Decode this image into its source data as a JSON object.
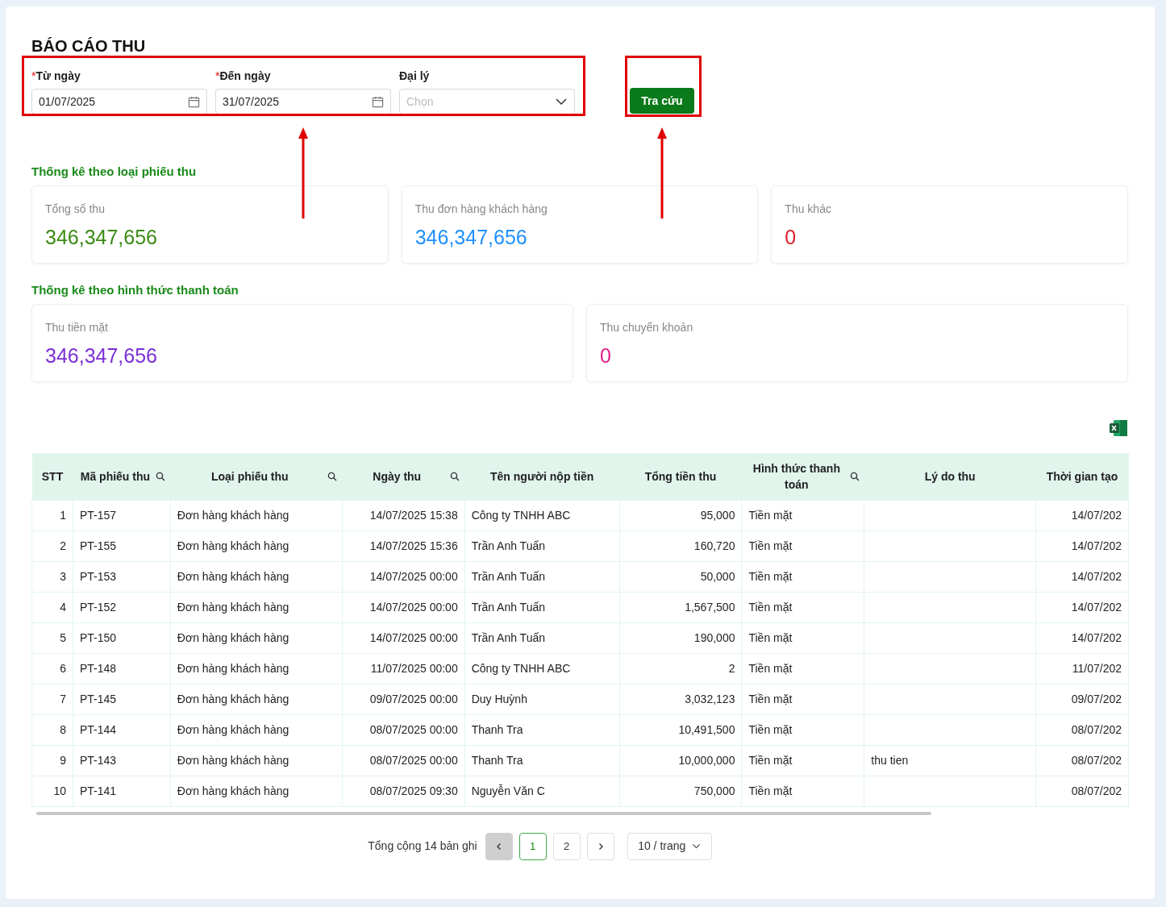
{
  "title": "BÁO CÁO THU",
  "filters": [
    {
      "kind": "date",
      "required_mark": "*",
      "label": "Từ ngày",
      "value": "01/07/2025"
    },
    {
      "kind": "date",
      "required_mark": "*",
      "label": "Đến ngày",
      "value": "31/07/2025"
    },
    {
      "kind": "select",
      "label": "Đại lý",
      "placeholder": "Chọn"
    }
  ],
  "search_button": "Tra cứu",
  "sections": [
    {
      "title": "Thống kê theo loại phiếu thu",
      "cards": [
        {
          "label": "Tổng số thu",
          "value": "346,347,656",
          "color": "#3a8a14"
        },
        {
          "label": "Thu đơn hàng khách hàng",
          "value": "346,347,656",
          "color": "#1e90ff"
        },
        {
          "label": "Thu khác",
          "value": "0",
          "color": "#e0202a"
        }
      ]
    },
    {
      "title": "Thống kê theo hình thức thanh toán",
      "cards": [
        {
          "label": "Thu tiền mặt",
          "value": "346,347,656",
          "color": "#7b2fd6"
        },
        {
          "label": "Thu chuyển khoản",
          "value": "0",
          "color": "#e0208a"
        }
      ]
    }
  ],
  "table": {
    "columns": [
      {
        "label": "STT",
        "searchable": false
      },
      {
        "label": "Mã phiếu thu",
        "searchable": true
      },
      {
        "label": "Loại phiếu thu",
        "searchable": true
      },
      {
        "label": "Ngày thu",
        "searchable": true
      },
      {
        "label": "Tên người nộp tiền",
        "searchable": false
      },
      {
        "label": "Tổng tiền thu",
        "searchable": false
      },
      {
        "label": "Hình thức thanh toán",
        "searchable": true
      },
      {
        "label": "Lý do thu",
        "searchable": false
      },
      {
        "label": "Thời gian tạo",
        "searchable": false
      }
    ],
    "rows": [
      [
        "1",
        "PT-157",
        "Đơn hàng khách hàng",
        "14/07/2025 15:38",
        "Công ty TNHH ABC",
        "95,000",
        "Tiền mặt",
        "",
        "14/07/202"
      ],
      [
        "2",
        "PT-155",
        "Đơn hàng khách hàng",
        "14/07/2025 15:36",
        "Trần Anh Tuấn",
        "160,720",
        "Tiền mặt",
        "",
        "14/07/202"
      ],
      [
        "3",
        "PT-153",
        "Đơn hàng khách hàng",
        "14/07/2025 00:00",
        "Trần Anh Tuấn",
        "50,000",
        "Tiền mặt",
        "",
        "14/07/202"
      ],
      [
        "4",
        "PT-152",
        "Đơn hàng khách hàng",
        "14/07/2025 00:00",
        "Trần Anh Tuấn",
        "1,567,500",
        "Tiền mặt",
        "",
        "14/07/202"
      ],
      [
        "5",
        "PT-150",
        "Đơn hàng khách hàng",
        "14/07/2025 00:00",
        "Trần Anh Tuấn",
        "190,000",
        "Tiền mặt",
        "",
        "14/07/202"
      ],
      [
        "6",
        "PT-148",
        "Đơn hàng khách hàng",
        "11/07/2025 00:00",
        "Công ty TNHH ABC",
        "2",
        "Tiền mặt",
        "",
        "11/07/202"
      ],
      [
        "7",
        "PT-145",
        "Đơn hàng khách hàng",
        "09/07/2025 00:00",
        "Duy Huỳnh",
        "3,032,123",
        "Tiền mặt",
        "",
        "09/07/202"
      ],
      [
        "8",
        "PT-144",
        "Đơn hàng khách hàng",
        "08/07/2025 00:00",
        "Thanh Tra",
        "10,491,500",
        "Tiền mặt",
        "",
        "08/07/202"
      ],
      [
        "9",
        "PT-143",
        "Đơn hàng khách hàng",
        "08/07/2025 00:00",
        "Thanh Tra",
        "10,000,000",
        "Tiền mặt",
        "thu tien",
        "08/07/202"
      ],
      [
        "10",
        "PT-141",
        "Đơn hàng khách hàng",
        "08/07/2025 09:30",
        "Nguyễn Văn C",
        "750,000",
        "Tiền mặt",
        "",
        "08/07/202"
      ]
    ]
  },
  "pagination": {
    "total": "Tổng cộng 14 bản ghi",
    "prev_disabled": true,
    "pages": [
      {
        "label": "1",
        "selected": true
      },
      {
        "label": "2",
        "selected": false
      }
    ],
    "page_size": "10 / trang"
  }
}
